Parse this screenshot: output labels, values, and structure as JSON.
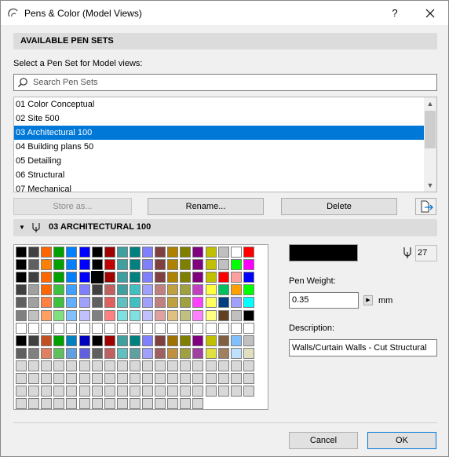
{
  "window": {
    "title": "Pens & Color (Model Views)",
    "help_label": "?"
  },
  "pen_sets": {
    "header": "AVAILABLE PEN SETS",
    "select_label": "Select a Pen Set for Model views:",
    "search_placeholder": "Search Pen Sets",
    "items": [
      {
        "label": "01 Color Conceptual"
      },
      {
        "label": "02 Site 500"
      },
      {
        "label": "03 Architectural 100"
      },
      {
        "label": "04 Building plans 50"
      },
      {
        "label": "05 Detailing"
      },
      {
        "label": "06 Structural"
      },
      {
        "label": "07 Mechanical"
      }
    ],
    "selected_index": 2,
    "buttons": {
      "store_as": "Store as...",
      "rename": "Rename...",
      "delete": "Delete"
    }
  },
  "pen_editor": {
    "header": "03 ARCHITECTURAL 100",
    "pen_number": "27",
    "current_color": "#000000",
    "pen_weight_label": "Pen Weight:",
    "pen_weight_value": "0.35",
    "pen_weight_unit": "mm",
    "description_label": "Description:",
    "description_value": "Walls/Curtain Walls - Cut Structural",
    "selected_pen_cell": [
      2,
      6
    ],
    "palette_rows": [
      [
        "#000000",
        "#404040",
        "#ff6600",
        "#00a000",
        "#0080ff",
        "#0000ff",
        "#000000",
        "#a00000",
        "#40a0a0",
        "#008080",
        "#8080ff",
        "#804040",
        "#b08000",
        "#808000",
        "#800080",
        "#c0c000",
        "#c0c0c0",
        "#ffffff",
        "#ff0000"
      ],
      [
        "#000000",
        "#606060",
        "#ff8000",
        "#00a000",
        "#0080ff",
        "#0000ff",
        "#000000",
        "#c00000",
        "#40a0a0",
        "#008080",
        "#8080ff",
        "#804040",
        "#b08000",
        "#808000",
        "#800080",
        "#c0c000",
        "#c0c0c0",
        "#00ff00",
        "#ff00ff"
      ],
      [
        "#000000",
        "#404040",
        "#ff6600",
        "#00a000",
        "#0080ff",
        "#0000ff",
        "#000000",
        "#a00000",
        "#40a0a0",
        "#008080",
        "#8080ff",
        "#804040",
        "#b08000",
        "#808000",
        "#800080",
        "#c0c000",
        "#ff0000",
        "#ffa0a0",
        "#0000ff"
      ],
      [
        "#404040",
        "#a0a0a0",
        "#ff6600",
        "#40c040",
        "#40a0ff",
        "#8080ff",
        "#404040",
        "#c06060",
        "#40a0a0",
        "#40c0c0",
        "#a0a0ff",
        "#c08080",
        "#c0a040",
        "#a0a040",
        "#c040c0",
        "#ffff40",
        "#00c060",
        "#ffa000",
        "#00ff00"
      ],
      [
        "#606060",
        "#a0a0a0",
        "#ff8040",
        "#40c040",
        "#60b0ff",
        "#a0a0ff",
        "#606060",
        "#e06060",
        "#60c0c0",
        "#40c0c0",
        "#a0a0ff",
        "#c08080",
        "#c0a040",
        "#a0a040",
        "#ff40ff",
        "#ffff60",
        "#004080",
        "#a0a0ff",
        "#00ffff"
      ],
      [
        "#808080",
        "#c0c0c0",
        "#ffa060",
        "#80e080",
        "#80c0ff",
        "#c0c0ff",
        "#808080",
        "#ff8080",
        "#80e0e0",
        "#80e0e0",
        "#c0c0ff",
        "#e0a0a0",
        "#e0c080",
        "#c0c080",
        "#ff80ff",
        "#ffff80",
        "#604020",
        "#c0c0c0",
        "#000000"
      ],
      [
        "#ffffff",
        "#ffffff",
        "#ffffff",
        "#ffffff",
        "#ffffff",
        "#ffffff",
        "#ffffff",
        "#ffffff",
        "#ffffff",
        "#ffffff",
        "#ffffff",
        "#ffffff",
        "#ffffff",
        "#ffffff",
        "#ffffff",
        "#ffffff",
        "#ffffff",
        "#ffffff",
        "#ffffff"
      ],
      [
        "#000000",
        "#404040",
        "#c05020",
        "#00a000",
        "#0080c0",
        "#0000c0",
        "#000000",
        "#a00000",
        "#40a0a0",
        "#008080",
        "#8080ff",
        "#804040",
        "#a07000",
        "#808000",
        "#800080",
        "#c0c000",
        "#806040",
        "#80c0ff",
        "#c0c0c0"
      ],
      [
        "#606060",
        "#808080",
        "#e08060",
        "#60c060",
        "#60a0e0",
        "#6060e0",
        "#606060",
        "#c06060",
        "#60c0c0",
        "#60a0a0",
        "#a0a0ff",
        "#a06060",
        "#c09040",
        "#a0a040",
        "#a040a0",
        "#e0e040",
        "#a08060",
        "#c0e0ff",
        "#e0e0c0"
      ],
      [
        "#d8d8d8",
        "#d8d8d8",
        "#d8d8d8",
        "#d8d8d8",
        "#d8d8d8",
        "#d8d8d8",
        "#d8d8d8",
        "#d8d8d8",
        "#d8d8d8",
        "#d8d8d8",
        "#d8d8d8",
        "#d8d8d8",
        "#d8d8d8",
        "#d8d8d8",
        "#d8d8d8",
        "#d8d8d8",
        "#d8d8d8",
        "#d8d8d8",
        "#d8d8d8"
      ],
      [
        "#d8d8d8",
        "#d8d8d8",
        "#d8d8d8",
        "#d8d8d8",
        "#d8d8d8",
        "#d8d8d8",
        "#d8d8d8",
        "#d8d8d8",
        "#d8d8d8",
        "#d8d8d8",
        "#d8d8d8",
        "#d8d8d8",
        "#d8d8d8",
        "#d8d8d8",
        "#d8d8d8",
        "#d8d8d8",
        "#d8d8d8",
        "#d8d8d8",
        "#d8d8d8"
      ],
      [
        "#d8d8d8",
        "#d8d8d8",
        "#d8d8d8",
        "#d8d8d8",
        "#d8d8d8",
        "#d8d8d8",
        "#d8d8d8",
        "#d8d8d8",
        "#d8d8d8",
        "#d8d8d8",
        "#d8d8d8",
        "#d8d8d8",
        "#d8d8d8",
        "#d8d8d8",
        "#d8d8d8",
        "#d8d8d8",
        "#d8d8d8",
        "#d8d8d8",
        "#d8d8d8"
      ],
      [
        "#d8d8d8",
        "#d8d8d8",
        "#d8d8d8",
        "#d8d8d8",
        "#d8d8d8",
        "#d8d8d8",
        "#d8d8d8",
        "#d8d8d8",
        "#d8d8d8",
        "#d8d8d8",
        "#d8d8d8",
        "#d8d8d8",
        "#d8d8d8",
        "#d8d8d8",
        "#d8d8d8"
      ]
    ]
  },
  "footer": {
    "cancel": "Cancel",
    "ok": "OK"
  },
  "icons": {
    "app": "arc-icon",
    "search": "search-icon",
    "pen": "pen-icon",
    "export": "export-icon",
    "close": "close-icon"
  },
  "colors": {
    "selection": "#0078d7",
    "section_header": "#dcdcdc",
    "dialog_bg": "#f0f0f0"
  }
}
